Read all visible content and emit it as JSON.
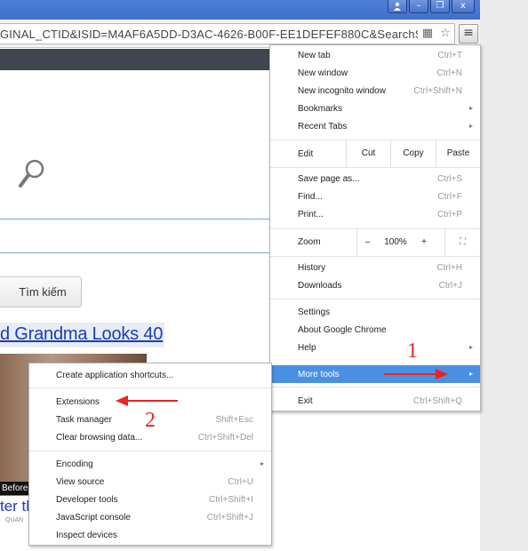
{
  "window": {
    "user_icon": "person-icon",
    "minimize": "–",
    "restore": "❐",
    "close": "x"
  },
  "toolbar": {
    "url": "GINAL_CTID&ISID=M4AF6A5DD-D3AC-4626-B00F-EE1DEFEF880C&SearchS",
    "page_icon": "▦",
    "star_icon": "☆",
    "menu_icon": "≡"
  },
  "page": {
    "search_button": "Tìm kiếm",
    "ad_headline": "d Grandma Looks 40",
    "ad_before": "Before",
    "ad_sub": "ter th",
    "ad_source": "QUAN"
  },
  "menu": {
    "new_tab": {
      "label": "New tab",
      "shortcut": "Ctrl+T"
    },
    "new_window": {
      "label": "New window",
      "shortcut": "Ctrl+N"
    },
    "new_incognito": {
      "label": "New incognito window",
      "shortcut": "Ctrl+Shift+N"
    },
    "bookmarks": {
      "label": "Bookmarks"
    },
    "recent_tabs": {
      "label": "Recent Tabs"
    },
    "edit": {
      "label": "Edit",
      "cut": "Cut",
      "copy": "Copy",
      "paste": "Paste"
    },
    "save_page": {
      "label": "Save page as...",
      "shortcut": "Ctrl+S"
    },
    "find": {
      "label": "Find...",
      "shortcut": "Ctrl+F"
    },
    "print": {
      "label": "Print...",
      "shortcut": "Ctrl+P"
    },
    "zoom": {
      "label": "Zoom",
      "minus": "–",
      "level": "100%",
      "plus": "+",
      "fullscreen": "⛶"
    },
    "history": {
      "label": "History",
      "shortcut": "Ctrl+H"
    },
    "downloads": {
      "label": "Downloads",
      "shortcut": "Ctrl+J"
    },
    "settings": {
      "label": "Settings"
    },
    "about": {
      "label": "About Google Chrome"
    },
    "help": {
      "label": "Help"
    },
    "more_tools": {
      "label": "More tools"
    },
    "exit": {
      "label": "Exit",
      "shortcut": "Ctrl+Shift+Q"
    },
    "arrow": "▸",
    "highlight_color": "#4a90e2"
  },
  "submenu": {
    "create_shortcuts": {
      "label": "Create application shortcuts..."
    },
    "extensions": {
      "label": "Extensions"
    },
    "task_manager": {
      "label": "Task manager",
      "shortcut": "Shift+Esc"
    },
    "clear_data": {
      "label": "Clear browsing data...",
      "shortcut": "Ctrl+Shift+Del"
    },
    "encoding": {
      "label": "Encoding"
    },
    "view_source": {
      "label": "View source",
      "shortcut": "Ctrl+U"
    },
    "dev_tools": {
      "label": "Developer tools",
      "shortcut": "Ctrl+Shift+I"
    },
    "js_console": {
      "label": "JavaScript console",
      "shortcut": "Ctrl+Shift+J"
    },
    "inspect_devices": {
      "label": "Inspect devices"
    }
  },
  "annotations": {
    "step1": "1",
    "step2": "2",
    "color": "#e8251f"
  }
}
